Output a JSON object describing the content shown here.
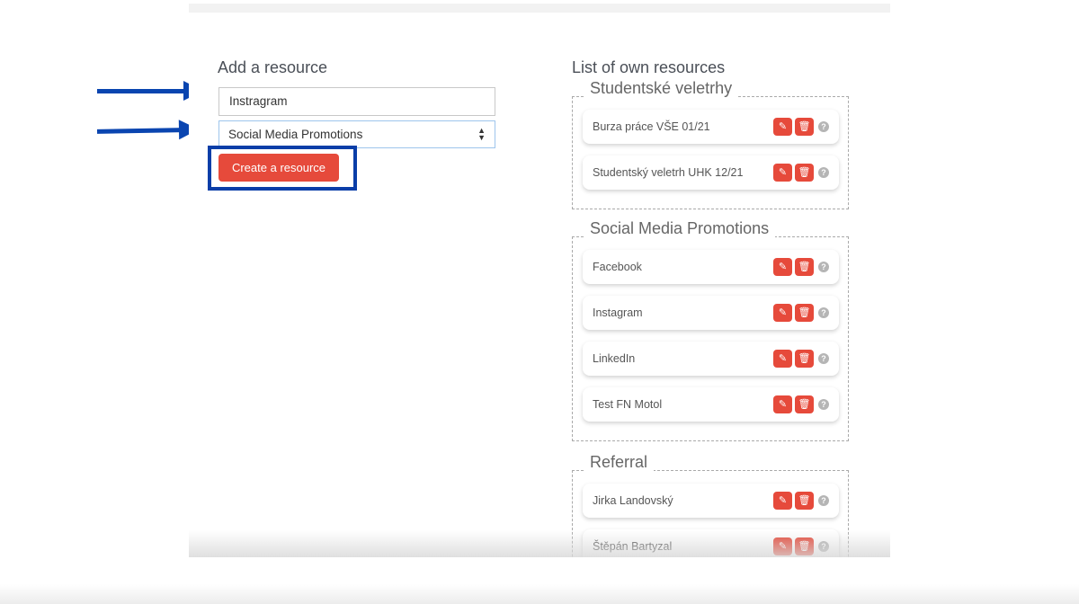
{
  "add": {
    "title": "Add a resource",
    "name_value": "Instragram",
    "category_value": "Social Media Promotions",
    "create_label": "Create a resource"
  },
  "list": {
    "title": "List of own resources",
    "groups": [
      {
        "name": "Studentské veletrhy",
        "items": [
          "Burza práce VŠE 01/21",
          "Studentský veletrh UHK 12/21"
        ]
      },
      {
        "name": "Social Media Promotions",
        "items": [
          "Facebook",
          "Instagram",
          "LinkedIn",
          "Test FN Motol"
        ]
      },
      {
        "name": "Referral",
        "items": [
          "Jirka Landovský",
          "Štěpán Bartyzal"
        ]
      }
    ]
  },
  "icons": {
    "edit": "pencil-icon",
    "delete": "trash-icon",
    "help": "question-circle-icon"
  },
  "colors": {
    "accent": "#e64a3b",
    "annotation": "#0a3ea8"
  }
}
